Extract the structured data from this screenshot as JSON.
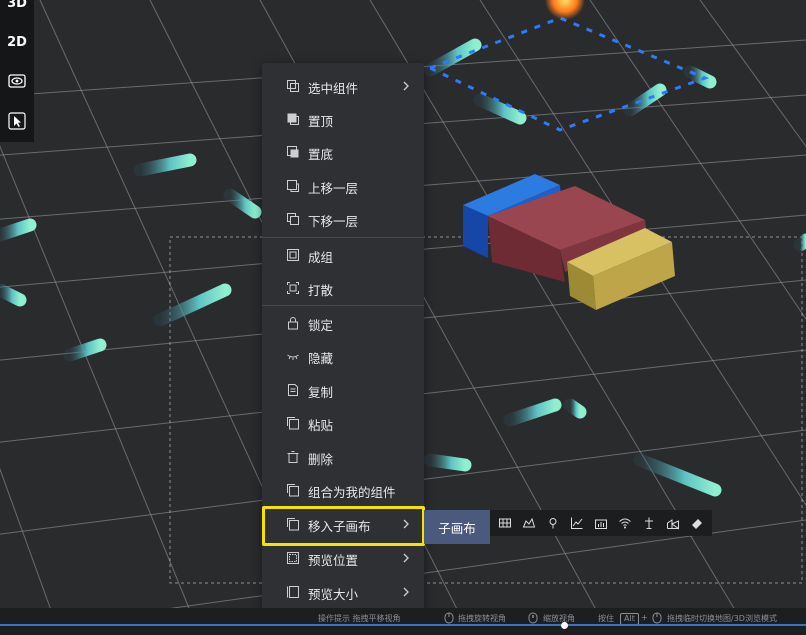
{
  "view_toggle": {
    "label_3d": "3D",
    "label_2d": "2D"
  },
  "context_menu": {
    "items": [
      {
        "label": "选中组件",
        "icon": "layers-icon",
        "submenu": true
      },
      {
        "label": "置顶",
        "icon": "bring-to-front-icon",
        "submenu": false
      },
      {
        "label": "置底",
        "icon": "send-to-back-icon",
        "submenu": false
      },
      {
        "label": "上移一层",
        "icon": "move-up-layer-icon",
        "submenu": false
      },
      {
        "label": "下移一层",
        "icon": "move-down-layer-icon",
        "submenu": false
      },
      {
        "label": "成组",
        "icon": "group-icon",
        "submenu": false
      },
      {
        "label": "打散",
        "icon": "ungroup-icon",
        "submenu": false
      },
      {
        "label": "锁定",
        "icon": "lock-icon",
        "submenu": false
      },
      {
        "label": "隐藏",
        "icon": "hide-icon",
        "submenu": false
      },
      {
        "label": "复制",
        "icon": "copy-icon",
        "submenu": false
      },
      {
        "label": "粘贴",
        "icon": "paste-icon",
        "submenu": false
      },
      {
        "label": "删除",
        "icon": "trash-icon",
        "submenu": false
      },
      {
        "label": "组合为我的组件",
        "icon": "save-component-icon",
        "submenu": false
      },
      {
        "label": "移入子画布",
        "icon": "move-to-subcanvas-icon",
        "submenu": true
      },
      {
        "label": "预览位置",
        "icon": "preview-position-icon",
        "submenu": true
      },
      {
        "label": "预览大小",
        "icon": "preview-size-icon",
        "submenu": true
      }
    ],
    "highlight_color": "#f4e300"
  },
  "submenu": {
    "label": "子画布"
  },
  "status_bar": {
    "hint_pan": "操作提示  拖拽平移视角",
    "hint_rotate": "拖拽旋转视角",
    "hint_zoom": "缩放视角",
    "hint_hold": "按住",
    "key_alt": "Alt",
    "key_plus": "+",
    "hint_switch": "拖拽临时切换地图/3D浏览模式"
  },
  "colors": {
    "ground": "#2a2b2d",
    "menu_bg": "#2e3033",
    "submenu_bg": "#4a5a7f",
    "accent_blue": "#3a73c4",
    "tube_cyan": "#6ad6c6",
    "container_blue": "#1f5fc7",
    "container_red": "#8a3b45",
    "container_yellow": "#c9b24a"
  }
}
